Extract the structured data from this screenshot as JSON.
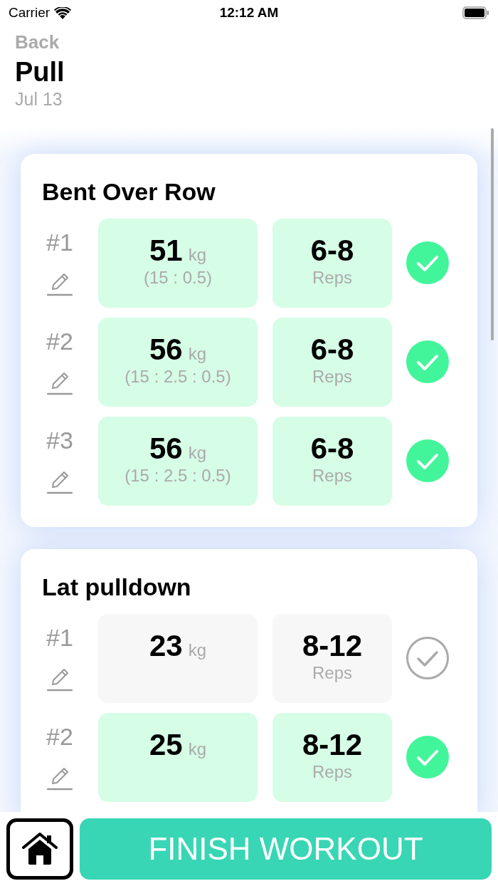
{
  "status_bar": {
    "carrier": "Carrier",
    "time": "12:12 AM"
  },
  "header": {
    "back": "Back",
    "title": "Pull",
    "date": "Jul 13"
  },
  "exercises": [
    {
      "name": "Bent Over Row",
      "sets": [
        {
          "label": "#1",
          "weight": "51",
          "unit": "kg",
          "breakdown": "(15 : 0.5)",
          "reps": "6-8",
          "reps_label": "Reps",
          "completed": true
        },
        {
          "label": "#2",
          "weight": "56",
          "unit": "kg",
          "breakdown": "(15 : 2.5 : 0.5)",
          "reps": "6-8",
          "reps_label": "Reps",
          "completed": true
        },
        {
          "label": "#3",
          "weight": "56",
          "unit": "kg",
          "breakdown": "(15 : 2.5 : 0.5)",
          "reps": "6-8",
          "reps_label": "Reps",
          "completed": true
        }
      ]
    },
    {
      "name": "Lat pulldown",
      "sets": [
        {
          "label": "#1",
          "weight": "23",
          "unit": "kg",
          "reps": "8-12",
          "reps_label": "Reps",
          "completed": false
        },
        {
          "label": "#2",
          "weight": "25",
          "unit": "kg",
          "reps": "8-12",
          "reps_label": "Reps",
          "completed": true
        }
      ]
    }
  ],
  "bottom_bar": {
    "finish": "FINISH WORKOUT"
  }
}
